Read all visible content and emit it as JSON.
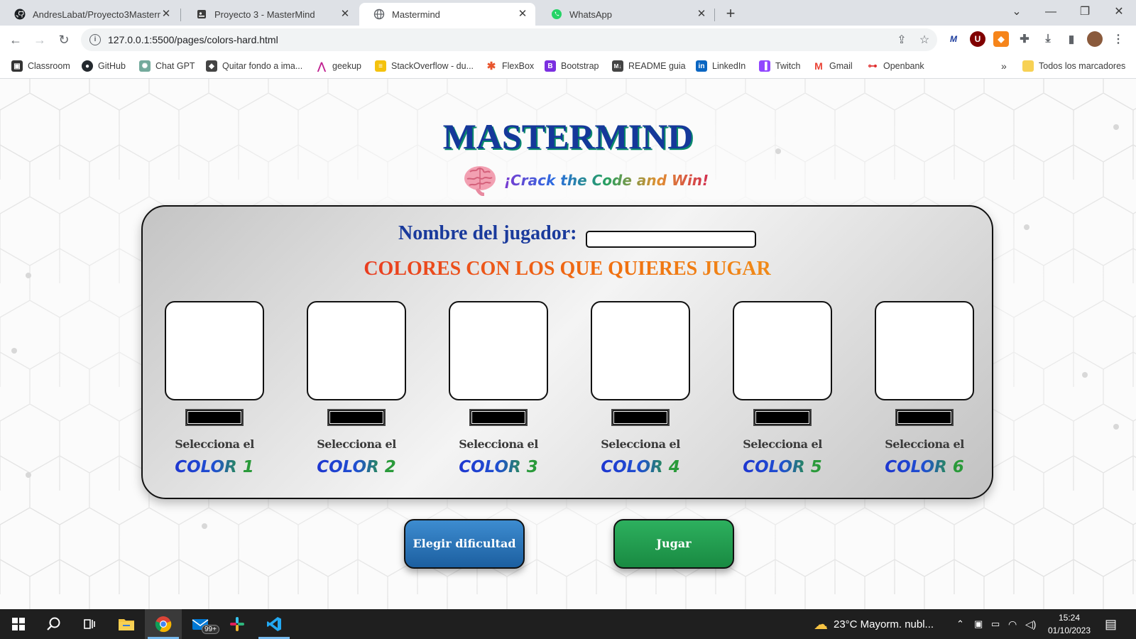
{
  "browser": {
    "tabs": [
      {
        "title": "AndresLabat/Proyecto3Masterm",
        "icon": "github-icon"
      },
      {
        "title": "Proyecto 3 - MasterMind",
        "icon": "document-icon"
      },
      {
        "title": "Mastermind",
        "icon": "globe-icon"
      },
      {
        "title": "WhatsApp",
        "icon": "whatsapp-icon"
      }
    ],
    "active_tab": 2,
    "url": "127.0.0.1:5500/pages/colors-hard.html",
    "bookmarks": [
      {
        "label": "Classroom",
        "icon": "classroom-icon",
        "color": "#333333"
      },
      {
        "label": "GitHub",
        "icon": "github-icon",
        "color": "#24292e"
      },
      {
        "label": "Chat GPT",
        "icon": "chatgpt-icon",
        "color": "#74aa9c"
      },
      {
        "label": "Quitar fondo a ima...",
        "icon": "layers-icon",
        "color": "#444444"
      },
      {
        "label": "geekup",
        "icon": "geekup-icon",
        "color": "#c02090"
      },
      {
        "label": "StackOverflow - du...",
        "icon": "stackoverflow-icon",
        "color": "#f4c20d"
      },
      {
        "label": "FlexBox",
        "icon": "asterisk-icon",
        "color": "#e8552d"
      },
      {
        "label": "Bootstrap",
        "icon": "bootstrap-icon",
        "color": "#7b2fe0"
      },
      {
        "label": "README guia",
        "icon": "markdown-icon",
        "color": "#444444"
      },
      {
        "label": "LinkedIn",
        "icon": "linkedin-icon",
        "color": "#0a66c2"
      },
      {
        "label": "Twitch",
        "icon": "twitch-icon",
        "color": "#9146ff"
      },
      {
        "label": "Gmail",
        "icon": "gmail-icon",
        "color": "#ea4335"
      },
      {
        "label": "Openbank",
        "icon": "openbank-icon",
        "color": "#e03030"
      }
    ],
    "all_bookmarks_label": "Todos los marcadores",
    "overflow_label": "»"
  },
  "page": {
    "title": "MASTERMIND",
    "subtitle": "¡Crack the Code and Win!",
    "player_label": "Nombre del jugador:",
    "player_name_value": "",
    "colors_heading": "COLORES CON LOS QUE QUIERES JUGAR",
    "color_slots": [
      {
        "select_label": "Selecciona el",
        "color_label": "COLOR 1",
        "value": "#000000"
      },
      {
        "select_label": "Selecciona el",
        "color_label": "COLOR 2",
        "value": "#000000"
      },
      {
        "select_label": "Selecciona el",
        "color_label": "COLOR 3",
        "value": "#000000"
      },
      {
        "select_label": "Selecciona el",
        "color_label": "COLOR 4",
        "value": "#000000"
      },
      {
        "select_label": "Selecciona el",
        "color_label": "COLOR 5",
        "value": "#000000"
      },
      {
        "select_label": "Selecciona el",
        "color_label": "COLOR 6",
        "value": "#000000"
      }
    ],
    "difficulty_button": "Elegir dificultad",
    "play_button": "Jugar"
  },
  "taskbar": {
    "weather": "23°C  Mayorm. nubl...",
    "time": "15:24",
    "date": "01/10/2023",
    "mail_badge": "99+"
  }
}
